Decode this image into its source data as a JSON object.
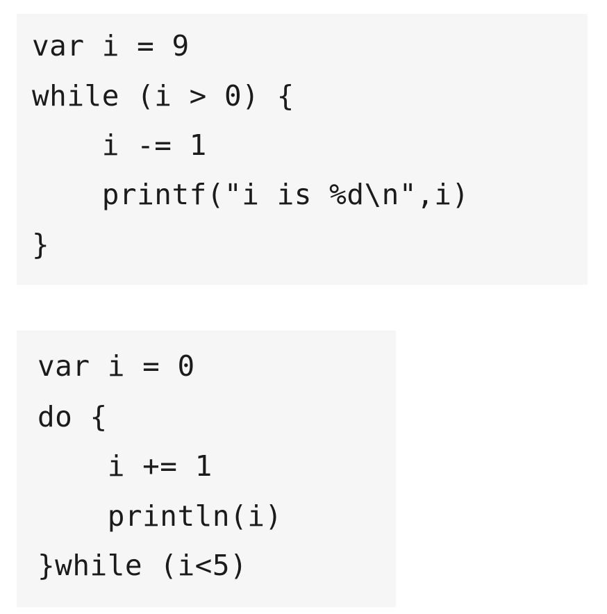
{
  "blocks": [
    {
      "lines": [
        "var i = 9",
        "while (i > 0) {",
        "    i -= 1",
        "    printf(\"i is %d\\n\",i)",
        "}"
      ]
    },
    {
      "lines": [
        "var i = 0",
        "do {",
        "    i += 1",
        "    println(i)",
        "}while (i<5)"
      ]
    }
  ],
  "colors": {
    "background": "#ffffff",
    "code_background": "#f6f6f7",
    "code_text": "#1b1b1b"
  }
}
